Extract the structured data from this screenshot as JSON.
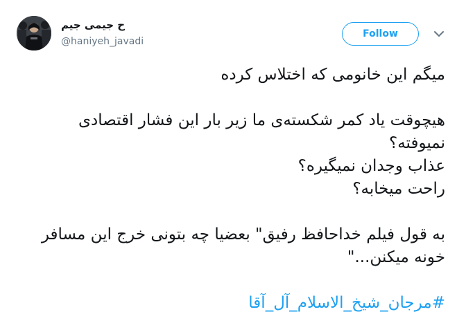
{
  "user": {
    "display_name": "ح جیمی جیم",
    "handle": "@haniyeh_javadi"
  },
  "header": {
    "follow_label": "Follow"
  },
  "icons": {
    "caret": "chevron-down-icon"
  },
  "colors": {
    "accent": "#1da1f2",
    "text": "#14171a",
    "secondary_text": "#657786"
  },
  "tweet": {
    "paragraphs": [
      [
        "میگم این خانومی که اختلاس کرده"
      ],
      [
        "هیچوقت یاد کمر شکسته‌ی ما زیر بار این فشار اقتصادی نمیوفته؟",
        "عذاب وجدان نمیگیره؟",
        "راحت میخابه؟"
      ],
      [
        "به قول فیلم خداحافظ رفیق\" بعضیا چه بتونی خرج این مسافر خونه میکنن...\""
      ]
    ],
    "hashtag": "#مرجان_شیخ_الاسلام_آل_آقا"
  }
}
